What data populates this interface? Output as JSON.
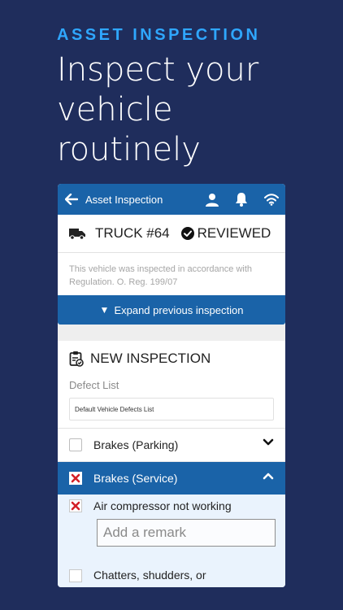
{
  "promo": {
    "kicker": "ASSET INSPECTION",
    "headline": "Inspect your vehicle routinely"
  },
  "appbar": {
    "title": "Asset Inspection",
    "icons": [
      "back-arrow-icon",
      "user-icon",
      "bell-icon",
      "wifi-icon"
    ]
  },
  "vehicle": {
    "name": "TRUCK #64",
    "status": "REVIEWED",
    "note": "This vehicle was inspected in accordance with Regulation. O. Reg. 199/07"
  },
  "expand_label": "Expand previous inspection",
  "new_inspection": {
    "title": "NEW INSPECTION",
    "defect_list_label": "Defect List",
    "defect_list_value": "Default Vehicle Defects List"
  },
  "defects": [
    {
      "label": "Brakes (Parking)",
      "checked": false
    },
    {
      "label": "Brakes (Service)",
      "checked": true
    }
  ],
  "sub_defect": {
    "label": "Air compressor not working",
    "checked": true,
    "remark_placeholder": "Add a remark"
  },
  "cut_item": {
    "label": "Chatters, shudders, or"
  },
  "colors": {
    "background": "#1f2d5c",
    "kicker": "#2fa7ff",
    "primary": "#1a63a8",
    "check_red": "#d32027"
  }
}
